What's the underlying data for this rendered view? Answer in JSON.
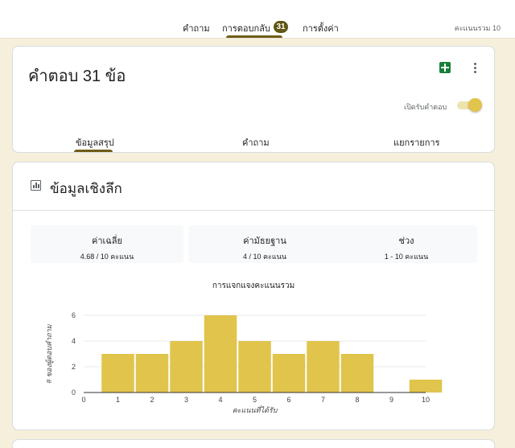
{
  "top_tabs": [
    {
      "label": "คำถาม"
    },
    {
      "label": "การตอบกลับ",
      "badge": "31"
    },
    {
      "label": "การตั้งค่า"
    }
  ],
  "total_points": "คะแนนรวม 10",
  "responses": {
    "title": "คำตอบ 31 ข้อ",
    "accepting_label": "เปิดรับคำตอบ",
    "accepting": true,
    "sub_tabs": [
      "ข้อมูลสรุป",
      "คำถาม",
      "แยกรายการ"
    ],
    "active_sub_tab": "ข้อมูลสรุป"
  },
  "insights": {
    "title": "ข้อมูลเชิงลึก",
    "stats": [
      {
        "label": "ค่าเฉลี่ย",
        "value": "4.68 / 10 คะแนน"
      },
      {
        "label": "ค่ามัธยฐาน",
        "value": "4 / 10 คะแนน"
      },
      {
        "label": "ช่วง",
        "value": "1 - 10 คะแนน"
      }
    ]
  },
  "chart_data": {
    "type": "bar",
    "title": "การแจกแจงคะแนนรวม",
    "xlabel": "คะแนนที่ได้รับ",
    "ylabel": "# ของผู้ตอบคำถาม",
    "x": [
      1,
      2,
      3,
      4,
      5,
      6,
      7,
      8,
      10
    ],
    "values": [
      3,
      3,
      4,
      6,
      4,
      3,
      4,
      3,
      1
    ],
    "x_ticks": [
      "0",
      "1",
      "2",
      "3",
      "4",
      "5",
      "6",
      "7",
      "8",
      "9",
      "10"
    ],
    "y_ticks": [
      "0",
      "2",
      "4",
      "6"
    ],
    "xlim": [
      0,
      10
    ],
    "ylim": [
      0,
      6
    ],
    "bar_color": "#e0c44c",
    "grid": true
  },
  "colors": {
    "accent": "#6e5d16",
    "background": "#f5efdb"
  }
}
